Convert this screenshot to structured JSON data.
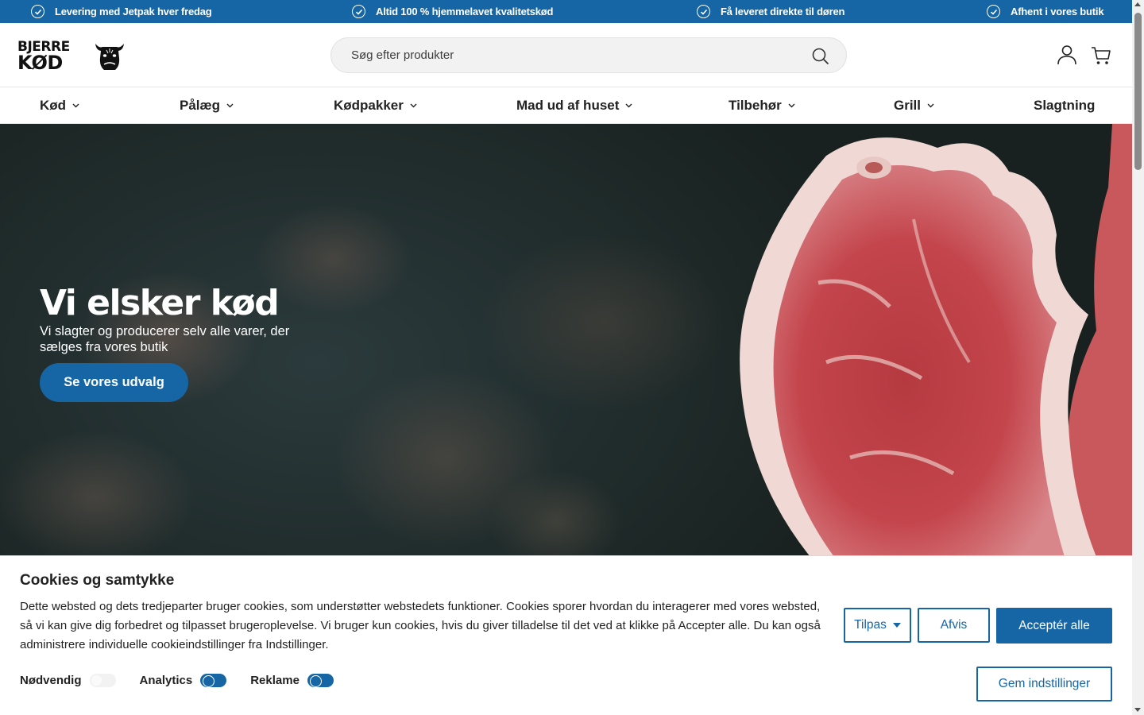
{
  "topbar": {
    "items": [
      {
        "icon": "check-circle-icon",
        "label": "Levering med Jetpak hver fredag"
      },
      {
        "icon": "check-circle-icon",
        "label": "Altid 100 % hjemmelavet kvalitetskød"
      },
      {
        "icon": "check-circle-icon",
        "label": "Få leveret direkte til døren"
      },
      {
        "icon": "check-circle-icon",
        "label": "Afhent i vores butik"
      }
    ],
    "background": "#1666a5"
  },
  "header": {
    "logo": {
      "line1": "BJERRE",
      "line2": "KØD"
    },
    "search": {
      "placeholder": "Søg efter produkter",
      "value": ""
    },
    "icons": [
      "search-icon",
      "user-icon",
      "cart-icon"
    ]
  },
  "nav": {
    "items": [
      {
        "label": "Kød",
        "dropdown": true
      },
      {
        "label": "Pålæg",
        "dropdown": true
      },
      {
        "label": "Kødpakker",
        "dropdown": true
      },
      {
        "label": "Mad ud af huset",
        "dropdown": true
      },
      {
        "label": "Tilbehør",
        "dropdown": true
      },
      {
        "label": "Grill",
        "dropdown": true
      },
      {
        "label": "Slagtning",
        "dropdown": false
      }
    ]
  },
  "hero": {
    "title": "Vi elsker kød",
    "subtitle": "Vi slagter og producerer selv alle varer, der sælges fra vores butik",
    "button": "Se vores udvalg"
  },
  "cookie": {
    "title": "Cookies og samtykke",
    "text": "Dette websted og dets tredjeparter bruger cookies, som understøtter webstedets funktioner. Cookies sporer hvordan du interagerer med vores websted, så vi kan give dig forbedret og tilpasset brugeroplevelse. Vi bruger kun cookies, hvis du giver tilladelse til det ved at klikke på Accepter alle. Du kan også administrere individuelle cookieindstillinger fra Indstillinger.",
    "toggles": [
      {
        "label": "Nødvendig",
        "state": "disabled"
      },
      {
        "label": "Analytics",
        "state": "on"
      },
      {
        "label": "Reklame",
        "state": "on"
      }
    ],
    "buttons": {
      "customize": "Tilpas",
      "reject": "Afvis",
      "accept": "Acceptér alle",
      "save": "Gem indstillinger"
    }
  },
  "colors": {
    "accent": "#1666a5"
  }
}
